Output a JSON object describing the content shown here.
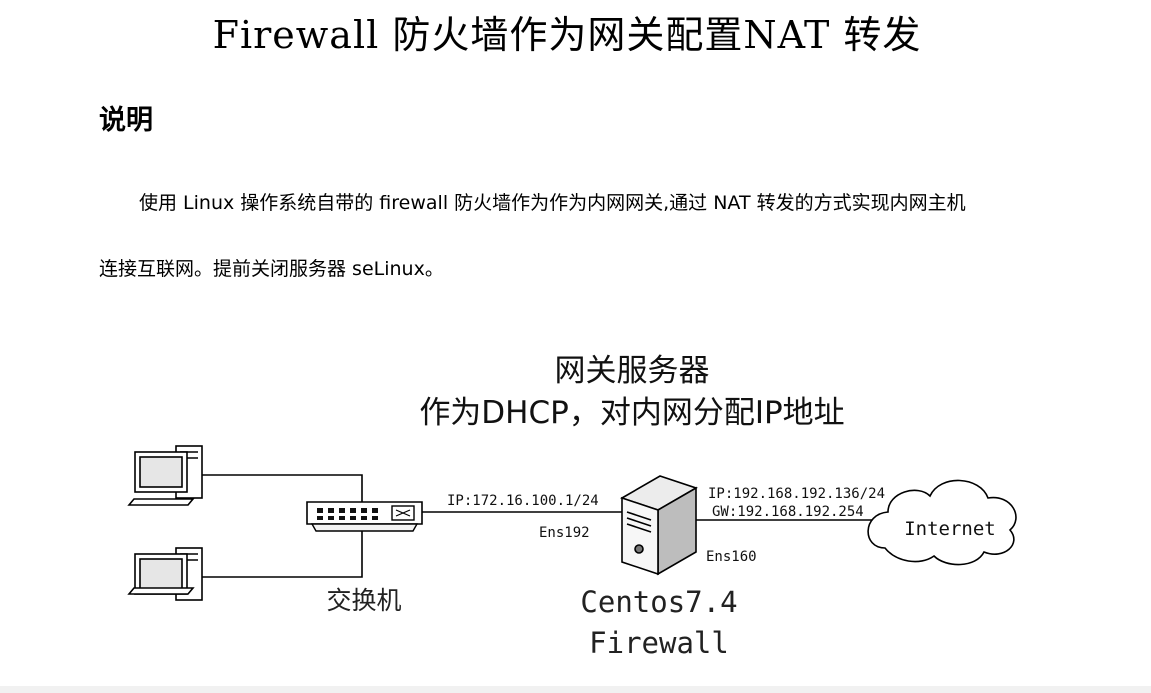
{
  "document": {
    "title": "Firewall 防火墙作为网关配置NAT 转发",
    "section_heading": "说明",
    "paragraph_line1": "使用 Linux 操作系统自带的 firewall 防火墙作为作为内网网关,通过 NAT 转发的方式实现内网主机",
    "paragraph_line2": "连接互联网。提前关闭服务器 seLinux。"
  },
  "diagram": {
    "header_line1": "网关服务器",
    "header_line2": "作为DHCP，对内网分配IP地址",
    "switch_label": "交换机",
    "inner_ip": "IP:172.16.100.1/24",
    "inner_iface": "Ens192",
    "outer_ip": "IP:192.168.192.136/24",
    "outer_gw": "GW:192.168.192.254",
    "outer_iface": "Ens160",
    "cloud_label": "Internet",
    "server_label_line1": "Centos7.4",
    "server_label_line2": "Firewall"
  }
}
